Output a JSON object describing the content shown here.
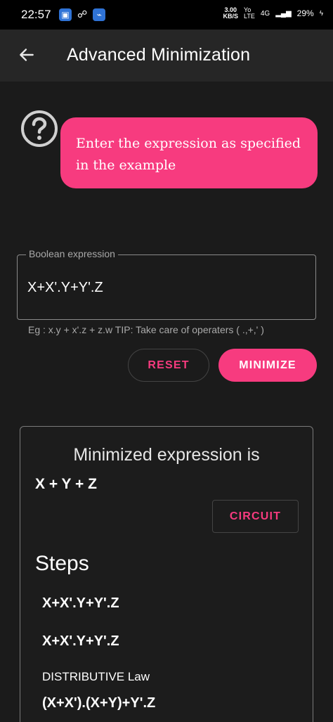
{
  "status_bar": {
    "time": "22:57",
    "speed": "3.00\nKB/S",
    "network": "4G",
    "battery": "29%"
  },
  "app_bar": {
    "title": "Advanced Minimization",
    "back_icon": "arrow-left-icon"
  },
  "tooltip": {
    "help_icon": "question-circle-icon",
    "text": "Enter the expression as specified in the example",
    "color": "#f73b7f"
  },
  "input": {
    "label": "Boolean expression",
    "value": "X+X'.Y+Y'.Z",
    "helper": "Eg : x.y + x'.z + z.w TIP: Take care of operaters ( .,+,' )"
  },
  "actions": {
    "reset_label": "RESET",
    "minimize_label": "MINIMIZE"
  },
  "result": {
    "heading": "Minimized expression is",
    "expression": "X + Y + Z",
    "circuit_label": "CIRCUIT",
    "steps_title": "Steps",
    "steps": [
      "X+X'.Y+Y'.Z",
      "X+X'.Y+Y'.Z",
      "DISTRIBUTIVE Law",
      "(X+X').(X+Y)+Y'.Z"
    ]
  }
}
